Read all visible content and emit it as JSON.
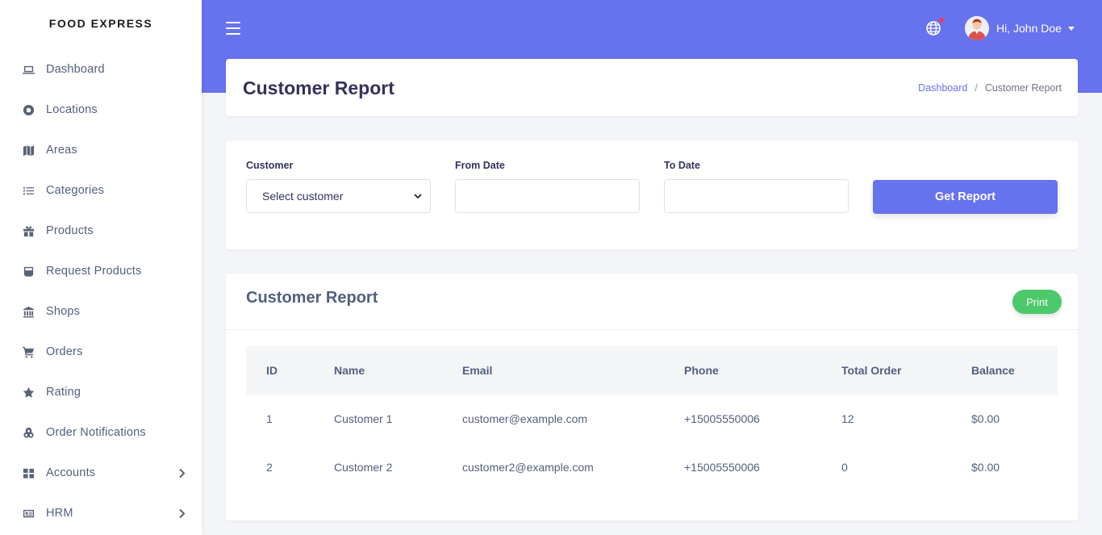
{
  "brand": "FOOD EXPRESS",
  "sidebar": {
    "items": [
      {
        "label": "Dashboard",
        "icon": "laptop-icon"
      },
      {
        "label": "Locations",
        "icon": "life-ring-icon"
      },
      {
        "label": "Areas",
        "icon": "map-icon"
      },
      {
        "label": "Categories",
        "icon": "list-icon"
      },
      {
        "label": "Products",
        "icon": "gift-icon"
      },
      {
        "label": "Request Products",
        "icon": "inbox-icon"
      },
      {
        "label": "Shops",
        "icon": "bank-icon"
      },
      {
        "label": "Orders",
        "icon": "cart-icon"
      },
      {
        "label": "Rating",
        "icon": "star-icon"
      },
      {
        "label": "Order Notifications",
        "icon": "cookie-icon"
      },
      {
        "label": "Accounts",
        "icon": "grid-icon",
        "has_submenu": true
      },
      {
        "label": "HRM",
        "icon": "id-card-icon",
        "has_submenu": true
      }
    ]
  },
  "topbar": {
    "user_name": "Hi, John Doe",
    "accent_color": "#6672ee"
  },
  "page": {
    "title": "Customer Report",
    "breadcrumb": {
      "home": "Dashboard",
      "separator": "/",
      "current": "Customer Report"
    }
  },
  "filters": {
    "customer_label": "Customer",
    "customer_value": "Select customer",
    "from_label": "From Date",
    "from_value": "",
    "to_label": "To Date",
    "to_value": "",
    "submit_label": "Get Report"
  },
  "report": {
    "title": "Customer Report",
    "print_label": "Print",
    "columns": [
      "ID",
      "Name",
      "Email",
      "Phone",
      "Total Order",
      "Balance"
    ],
    "rows": [
      [
        "1",
        "Customer 1",
        "customer@example.com",
        "+15005550006",
        "12",
        "$0.00"
      ],
      [
        "2",
        "Customer 2",
        "customer2@example.com",
        "+15005550006",
        "0",
        "$0.00"
      ]
    ]
  }
}
